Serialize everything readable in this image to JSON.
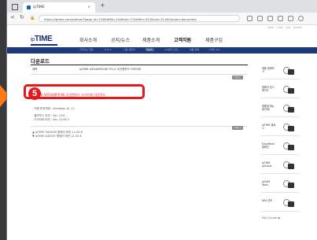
{
  "browser": {
    "tab_title": "ipTIME",
    "tab_close": "×",
    "new_tab": "+",
    "url": "https://iptime.com/iptime/?page_id=126&dffid=1&dfsid=17&dftid=523&uid=21181&mod=document"
  },
  "site": {
    "util_links": "HOME  LOGIN  JOIN  SITEMAP",
    "logo_prefix": "ip",
    "logo_main": "TIME",
    "gnb": [
      "회사소개",
      "공지/뉴스",
      "제품소개",
      "고객지원",
      "제품구입"
    ],
    "subnav": [
      "자주하는 질문",
      "Q & A",
      "사용 설명서",
      "다운로드",
      "A/S센터 안내",
      "제품 등록",
      "사이버 A/S"
    ],
    "page_title": "다운로드",
    "row_label": "제목",
    "row_title": "ipTIME AX5400PX-6E  PCI-E 무선랜카드 드라이버",
    "row_date": "2024.01.17",
    "download_label": "다운로드",
    "highlight_text": "ipTIME AX5400PX-6E 무선랜카드 드라이버 다운로드",
    "badge_number": "5",
    "info_lines": [
      "- 지원 운영체제 : Windows 10, 11",
      "- 블루투스 버전 : Ver. 1.00",
      "- 드라이버 버전 : Ver. 21.60.2"
    ],
    "next_items": [
      "▲ ipTIME FW400X 펌웨어 버전 11.00.6",
      "▼ ipTIME A3004T 펌웨어 버전 11.00.6"
    ],
    "list_label": "목록보기"
  },
  "sidebar": {
    "items": [
      "제품 등록하기",
      "펌웨어 업그레이드",
      "제품별 매뉴얼/자료",
      "ipTIME 블로그",
      "EasyMesh 캠페인",
      "ipTIME ipCloud",
      "ipCAM Tools",
      "NAS 관리"
    ],
    "faq": "FAQ Center ▶"
  },
  "colors": {
    "accent": "#e4191e",
    "nav_blue": "#1e3a78",
    "arrow": "#ff7a12"
  }
}
